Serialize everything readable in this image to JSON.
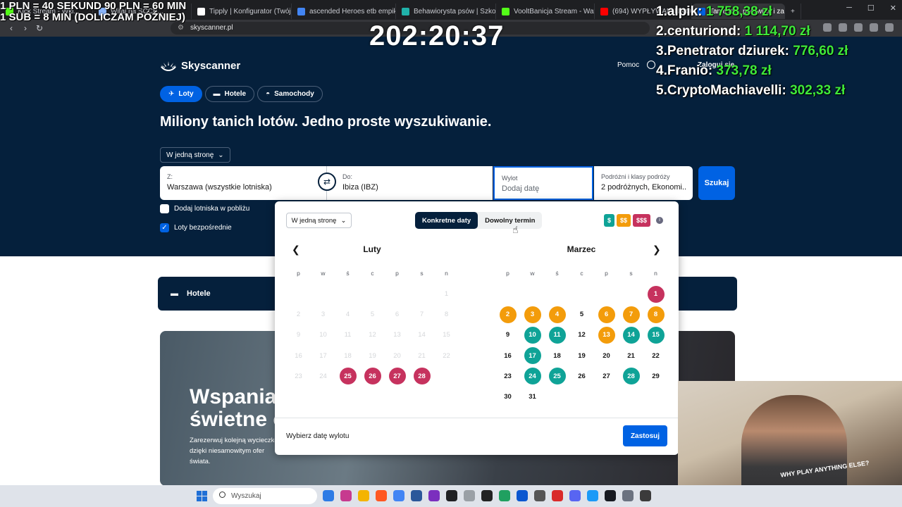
{
  "browser": {
    "tabs": [
      {
        "label": "Kick Stream - Wkl...",
        "color": "#53fc18"
      },
      {
        "label": "Witaj na SCCB...",
        "color": "#8ab4f8"
      },
      {
        "label": "Tipply | Konfigurator (Twój cel)",
        "color": "#ffffff"
      },
      {
        "label": "ascended Heroes etb empik - S",
        "color": "#4285f4"
      },
      {
        "label": "Behawiorysta psów | Szkolenie",
        "color": "#20b2aa"
      },
      {
        "label": "VooltBanicja Stream - Watch Li",
        "color": "#53fc18"
      },
      {
        "label": "(694) WYPŁYWAM NA OCEAN",
        "color": "#ff0000"
      },
      {
        "label": "Tanie loty, porównaj i zare",
        "color": "#0062e3"
      }
    ],
    "url": "skyscanner.pl",
    "controls": [
      "─",
      "☐",
      "✕"
    ]
  },
  "header": {
    "logo_text": "Skyscanner",
    "help_label": "Pomoc",
    "login_label": "Zaloguj się",
    "product_tabs": [
      "Loty",
      "Hotele",
      "Samochody"
    ],
    "headline": "Miliony tanich lotów. Jedno proste wyszukiwanie."
  },
  "search": {
    "trip_type": "W jedną stronę",
    "from_label": "Z:",
    "from_value": "Warszawa (wszystkie lotniska)",
    "to_label": "Do:",
    "to_value": "Ibiza (IBZ)",
    "depart_label": "Wylot",
    "depart_placeholder": "Dodaj datę",
    "travellers_label": "Podróżni i klasy podróży",
    "travellers_value": "2 podróżnych, Ekonomi...",
    "search_button": "Szukaj",
    "nearby_label": "Dodaj lotniska w pobliżu",
    "nearby_checked": false,
    "direct_label": "Loty bezpośrednie",
    "direct_checked": true
  },
  "page": {
    "hotels_banner": "Hotele",
    "promo_title": "Wspaniał świetne o",
    "promo_text": "Zarezerwuj kolejną wycieczkę dzięki niesamowitym ofer świata."
  },
  "calendar": {
    "trip_type": "W jedną stronę",
    "mode_specific": "Konkretne daty",
    "mode_flexible": "Dowolny termin",
    "active_mode": "specific",
    "price_legend": [
      {
        "label": "$",
        "color": "#0fa397"
      },
      {
        "label": "$$",
        "color": "#f39c0b"
      },
      {
        "label": "$$$",
        "color": "#c6325e"
      }
    ],
    "weekday_headers": [
      "p",
      "w",
      "ś",
      "c",
      "p",
      "s",
      "n"
    ],
    "hint": "Wybierz datę wylotu",
    "apply_button": "Zastosuj",
    "months": [
      {
        "name": "Luty",
        "weeks": [
          [
            null,
            null,
            null,
            null,
            null,
            null,
            {
              "d": "1",
              "p": "disabled"
            }
          ],
          [
            {
              "d": "2",
              "p": "disabled"
            },
            {
              "d": "3",
              "p": "disabled"
            },
            {
              "d": "4",
              "p": "disabled"
            },
            {
              "d": "5",
              "p": "disabled"
            },
            {
              "d": "6",
              "p": "disabled"
            },
            {
              "d": "7",
              "p": "disabled"
            },
            {
              "d": "8",
              "p": "disabled"
            }
          ],
          [
            {
              "d": "9",
              "p": "disabled"
            },
            {
              "d": "10",
              "p": "disabled"
            },
            {
              "d": "11",
              "p": "disabled"
            },
            {
              "d": "12",
              "p": "disabled"
            },
            {
              "d": "13",
              "p": "disabled"
            },
            {
              "d": "14",
              "p": "disabled"
            },
            {
              "d": "15",
              "p": "disabled"
            }
          ],
          [
            {
              "d": "16",
              "p": "disabled"
            },
            {
              "d": "17",
              "p": "disabled"
            },
            {
              "d": "18",
              "p": "disabled"
            },
            {
              "d": "19",
              "p": "disabled"
            },
            {
              "d": "20",
              "p": "disabled"
            },
            {
              "d": "21",
              "p": "disabled"
            },
            {
              "d": "22",
              "p": "disabled"
            }
          ],
          [
            {
              "d": "23",
              "p": "disabled"
            },
            {
              "d": "24",
              "p": "disabled"
            },
            {
              "d": "25",
              "p": "high"
            },
            {
              "d": "26",
              "p": "high"
            },
            {
              "d": "27",
              "p": "high"
            },
            {
              "d": "28",
              "p": "high"
            },
            null
          ]
        ]
      },
      {
        "name": "Marzec",
        "weeks": [
          [
            null,
            null,
            null,
            null,
            null,
            null,
            {
              "d": "1",
              "p": "high"
            }
          ],
          [
            {
              "d": "2",
              "p": "mid"
            },
            {
              "d": "3",
              "p": "mid"
            },
            {
              "d": "4",
              "p": "mid"
            },
            {
              "d": "5",
              "p": "none"
            },
            {
              "d": "6",
              "p": "mid"
            },
            {
              "d": "7",
              "p": "mid"
            },
            {
              "d": "8",
              "p": "mid"
            }
          ],
          [
            {
              "d": "9",
              "p": "none"
            },
            {
              "d": "10",
              "p": "low"
            },
            {
              "d": "11",
              "p": "low"
            },
            {
              "d": "12",
              "p": "none"
            },
            {
              "d": "13",
              "p": "mid"
            },
            {
              "d": "14",
              "p": "low"
            },
            {
              "d": "15",
              "p": "low"
            }
          ],
          [
            {
              "d": "16",
              "p": "none"
            },
            {
              "d": "17",
              "p": "low"
            },
            {
              "d": "18",
              "p": "none"
            },
            {
              "d": "19",
              "p": "none"
            },
            {
              "d": "20",
              "p": "none"
            },
            {
              "d": "21",
              "p": "none"
            },
            {
              "d": "22",
              "p": "none"
            }
          ],
          [
            {
              "d": "23",
              "p": "none"
            },
            {
              "d": "24",
              "p": "low"
            },
            {
              "d": "25",
              "p": "low"
            },
            {
              "d": "26",
              "p": "none"
            },
            {
              "d": "27",
              "p": "none"
            },
            {
              "d": "28",
              "p": "low"
            },
            {
              "d": "29",
              "p": "none"
            }
          ],
          [
            {
              "d": "30",
              "p": "none"
            },
            {
              "d": "31",
              "p": "none"
            },
            null,
            null,
            null,
            null,
            null
          ]
        ]
      }
    ]
  },
  "overlay": {
    "donation_line1": "1 PLN = 40 SEKUND 90 PLN = 60 MIN",
    "donation_line2": "1 SUB = 8 MIN (DOLICZAM PÓŹNIEJ)",
    "timer": "202:20:37",
    "leaderboard": [
      {
        "rank": "1.",
        "name": "alpik:",
        "amount": "1 758,38 zł"
      },
      {
        "rank": "2.",
        "name": "centuriond:",
        "amount": "1 114,70 zł"
      },
      {
        "rank": "3.",
        "name": "Penetrator dziurek:",
        "amount": "776,60 zł"
      },
      {
        "rank": "4.",
        "name": "Franio:",
        "amount": "373,78 zł"
      },
      {
        "rank": "5.",
        "name": "CryptoMachiavelli:",
        "amount": "302,33 zł"
      }
    ],
    "webcam_shirt_text": "WHY PLAY ANYTHING ELSE?"
  },
  "taskbar": {
    "search_placeholder": "Wyszukaj",
    "apps": [
      "#2d7be5",
      "#c73a8f",
      "#f4b400",
      "#ff5722",
      "#4285f4",
      "#2b579a",
      "#7b2fbe",
      "#202124",
      "#9aa0a6",
      "#222222",
      "#20a060",
      "#0b57d0",
      "#555555",
      "#d92a2a",
      "#5865f2",
      "#1b9af7",
      "#171a21",
      "#6b7280",
      "#3b3b3b"
    ]
  }
}
